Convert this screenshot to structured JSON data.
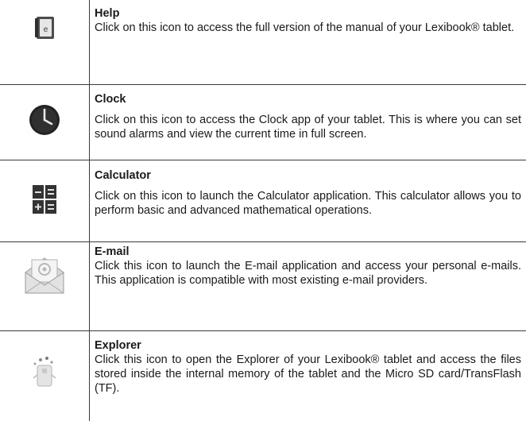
{
  "rows": [
    {
      "icon": "help-book-icon",
      "title": "Help",
      "description": "Click on this icon to access the full version of the manual of your Lexibook® tablet."
    },
    {
      "icon": "clock-icon",
      "title": "Clock",
      "description": "Click on this icon to access the Clock app of your tablet. This is where you can set sound alarms and view the current time in full screen."
    },
    {
      "icon": "calculator-icon",
      "title": "Calculator",
      "description": "Click on this icon to launch the Calculator application. This calculator allows you to perform basic and advanced mathematical operations."
    },
    {
      "icon": "email-envelope-icon",
      "title": "E-mail",
      "description": "Click this icon to launch the E-mail application and access your personal e-mails. This application is compatible with most existing e-mail providers."
    },
    {
      "icon": "explorer-icon",
      "title": "Explorer",
      "description": "Click this icon to open the Explorer of your Lexibook® tablet and access the files stored inside the internal memory of the tablet and the Micro SD card/TransFlash (TF)."
    }
  ]
}
